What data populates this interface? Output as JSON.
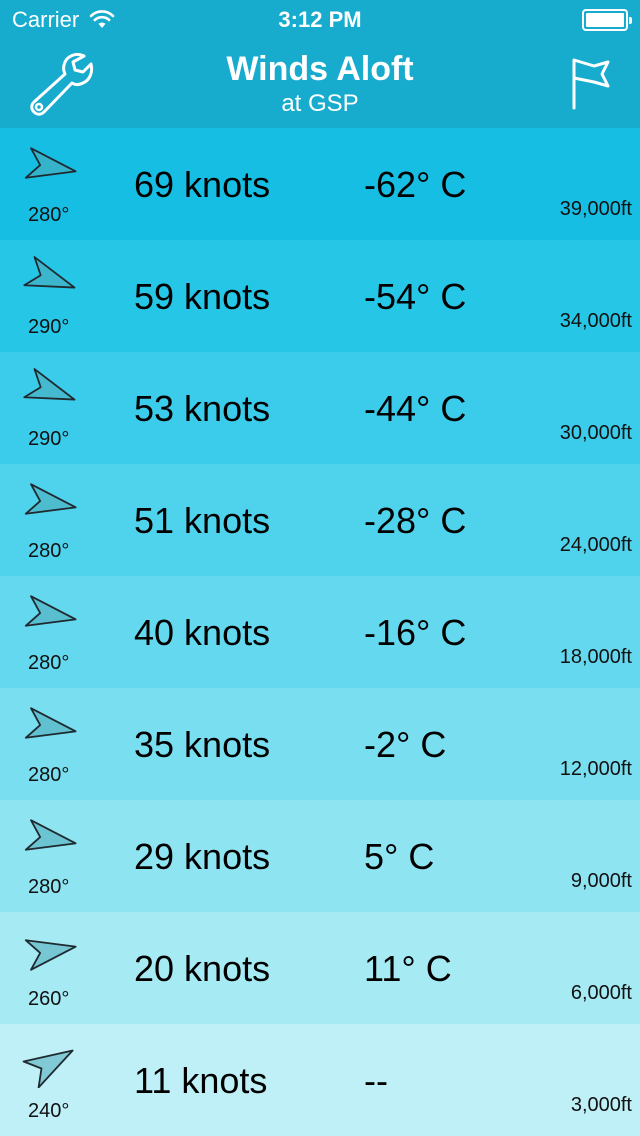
{
  "status_bar": {
    "carrier": "Carrier",
    "time": "3:12 PM",
    "wifi_icon": "wifi-icon",
    "battery_icon": "battery-icon"
  },
  "nav": {
    "title": "Winds Aloft",
    "subtitle": "at GSP",
    "left_icon": "wrench-icon",
    "right_icon": "flag-icon",
    "color": "#17abce"
  },
  "rows": [
    {
      "direction_label": "280°",
      "direction_deg": 280,
      "speed": "69 knots",
      "temp": "-62° C",
      "altitude": "39,000ft",
      "color": "#17bee3"
    },
    {
      "direction_label": "290°",
      "direction_deg": 290,
      "speed": "59 knots",
      "temp": "-54° C",
      "altitude": "34,000ft",
      "color": "#26c6e7"
    },
    {
      "direction_label": "290°",
      "direction_deg": 290,
      "speed": "53 knots",
      "temp": "-44° C",
      "altitude": "30,000ft",
      "color": "#3accea"
    },
    {
      "direction_label": "280°",
      "direction_deg": 280,
      "speed": "51 knots",
      "temp": "-28° C",
      "altitude": "24,000ft",
      "color": "#4fd2eb"
    },
    {
      "direction_label": "280°",
      "direction_deg": 280,
      "speed": "40 knots",
      "temp": "-16° C",
      "altitude": "18,000ft",
      "color": "#64d8ee"
    },
    {
      "direction_label": "280°",
      "direction_deg": 280,
      "speed": "35 knots",
      "temp": "-2° C",
      "altitude": "12,000ft",
      "color": "#79def0"
    },
    {
      "direction_label": "280°",
      "direction_deg": 280,
      "speed": "29 knots",
      "temp": "5° C",
      "altitude": "9,000ft",
      "color": "#8fe4f2"
    },
    {
      "direction_label": "260°",
      "direction_deg": 260,
      "speed": "20 knots",
      "temp": "11° C",
      "altitude": "6,000ft",
      "color": "#a6eaf4"
    },
    {
      "direction_label": "240°",
      "direction_deg": 240,
      "speed": "11 knots",
      "temp": "--",
      "altitude": "3,000ft",
      "color": "#bff0f7"
    }
  ]
}
